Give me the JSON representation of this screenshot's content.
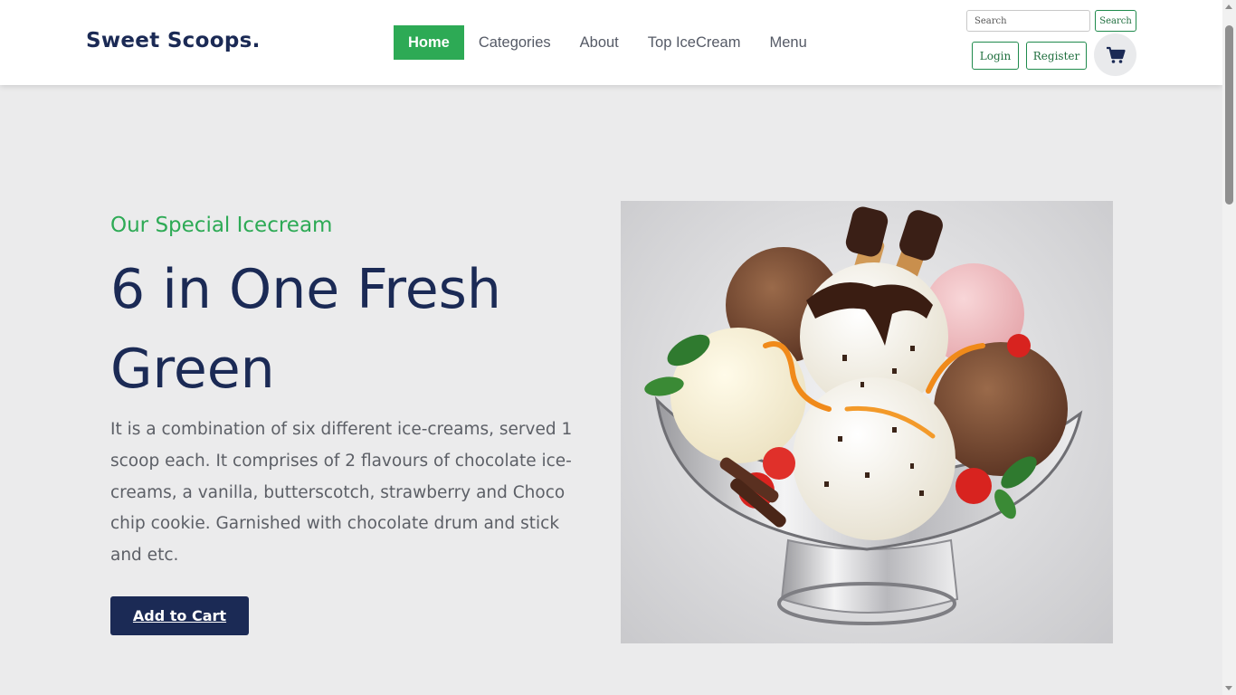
{
  "brand": {
    "logo_text": "Sweet Scoops."
  },
  "nav": {
    "items": [
      {
        "label": "Home",
        "active": true
      },
      {
        "label": "Categories",
        "active": false
      },
      {
        "label": "About",
        "active": false
      },
      {
        "label": "Top IceCream",
        "active": false
      },
      {
        "label": "Menu",
        "active": false
      }
    ]
  },
  "header_actions": {
    "search_placeholder": "Search",
    "search_button": "Search",
    "login_button": "Login",
    "register_button": "Register",
    "cart_icon": "shopping-cart-icon"
  },
  "hero": {
    "eyebrow": "Our Special Icecream",
    "title": "6 in One Fresh Green",
    "description": "It is a combination of six different ice-creams, served 1 scoop each. It comprises of 2 flavours of chocolate ice-creams, a vanilla, butterscotch, strawberry and Choco chip cookie. Garnished with chocolate drum and stick and etc.",
    "cta_label": "Add to Cart",
    "image_subject": "ice-cream-sundae-photo"
  },
  "colors": {
    "accent_green": "#2daa55",
    "brand_navy": "#1b2a55",
    "page_bg": "#ebebec"
  }
}
